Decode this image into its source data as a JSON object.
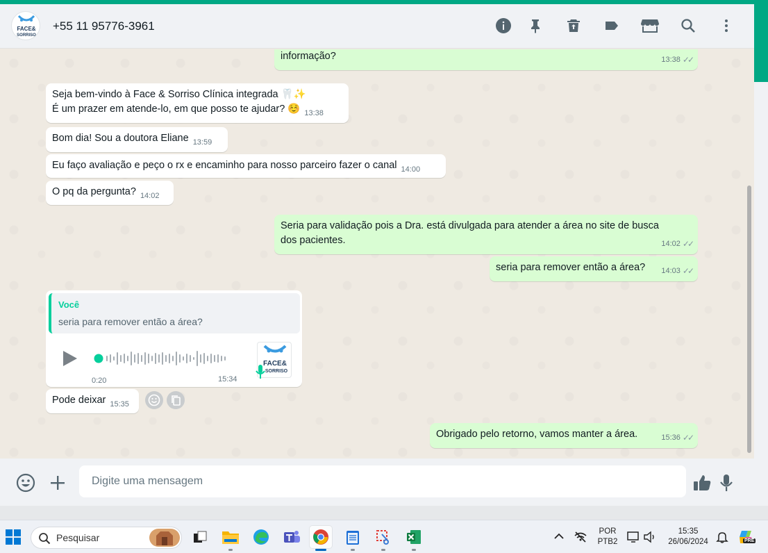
{
  "header": {
    "contact_name": "+55 11 95776-3961",
    "avatar_logo": {
      "top": "FACE&",
      "bottom": "SORRISO"
    }
  },
  "messages": [
    {
      "id": "m1",
      "direction": "out",
      "text_line": "informação?",
      "time": "13:38",
      "status": "read"
    },
    {
      "id": "m2",
      "direction": "in",
      "line1": "Seja bem-vindo à Face & Sorriso Clínica integrada 🦷✨",
      "line2": "É um prazer em atende-lo, em que posso te ajudar? ☺️",
      "time": "13:38"
    },
    {
      "id": "m3",
      "direction": "in",
      "text": "Bom dia! Sou a doutora Eliane",
      "time": "13:59"
    },
    {
      "id": "m4",
      "direction": "in",
      "text": "Eu faço avaliação e peço o rx e encaminho para nosso parceiro fazer o canal",
      "time": "14:00"
    },
    {
      "id": "m5",
      "direction": "in",
      "text": "O pq da pergunta?",
      "time": "14:02"
    },
    {
      "id": "m6",
      "direction": "out",
      "line1": "Seria para validação pois a Dra. está divulgada para atender a área no site de busca",
      "line2": "dos pacientes.",
      "time": "14:02",
      "status": "read"
    },
    {
      "id": "m7",
      "direction": "out",
      "text": "seria para remover então a área?",
      "time": "14:03",
      "status": "read"
    },
    {
      "id": "m8",
      "direction": "in",
      "type": "voice",
      "quote_author": "Você",
      "quote_text": "seria para remover então a área?",
      "duration": "0:20",
      "time": "15:34"
    },
    {
      "id": "m9",
      "direction": "in",
      "text": "Pode deixar",
      "time": "15:35"
    },
    {
      "id": "m10",
      "direction": "out",
      "text": "Obrigado pelo retorno, vamos manter a área.",
      "time": "15:36",
      "status": "read"
    }
  ],
  "composer": {
    "placeholder": "Digite uma mensagem",
    "value": ""
  },
  "taskbar": {
    "search_label": "Pesquisar",
    "language_top": "POR",
    "language_bottom": "PTB2",
    "clock_time": "15:35",
    "clock_date": "26/06/2024",
    "copilot_badge": "PRE"
  },
  "colors": {
    "accent": "#00a884",
    "outgoing_bubble": "#d9fdd3",
    "incoming_bubble": "#ffffff",
    "chat_bg": "#efeae2",
    "quote_author": "#06cf9c"
  }
}
